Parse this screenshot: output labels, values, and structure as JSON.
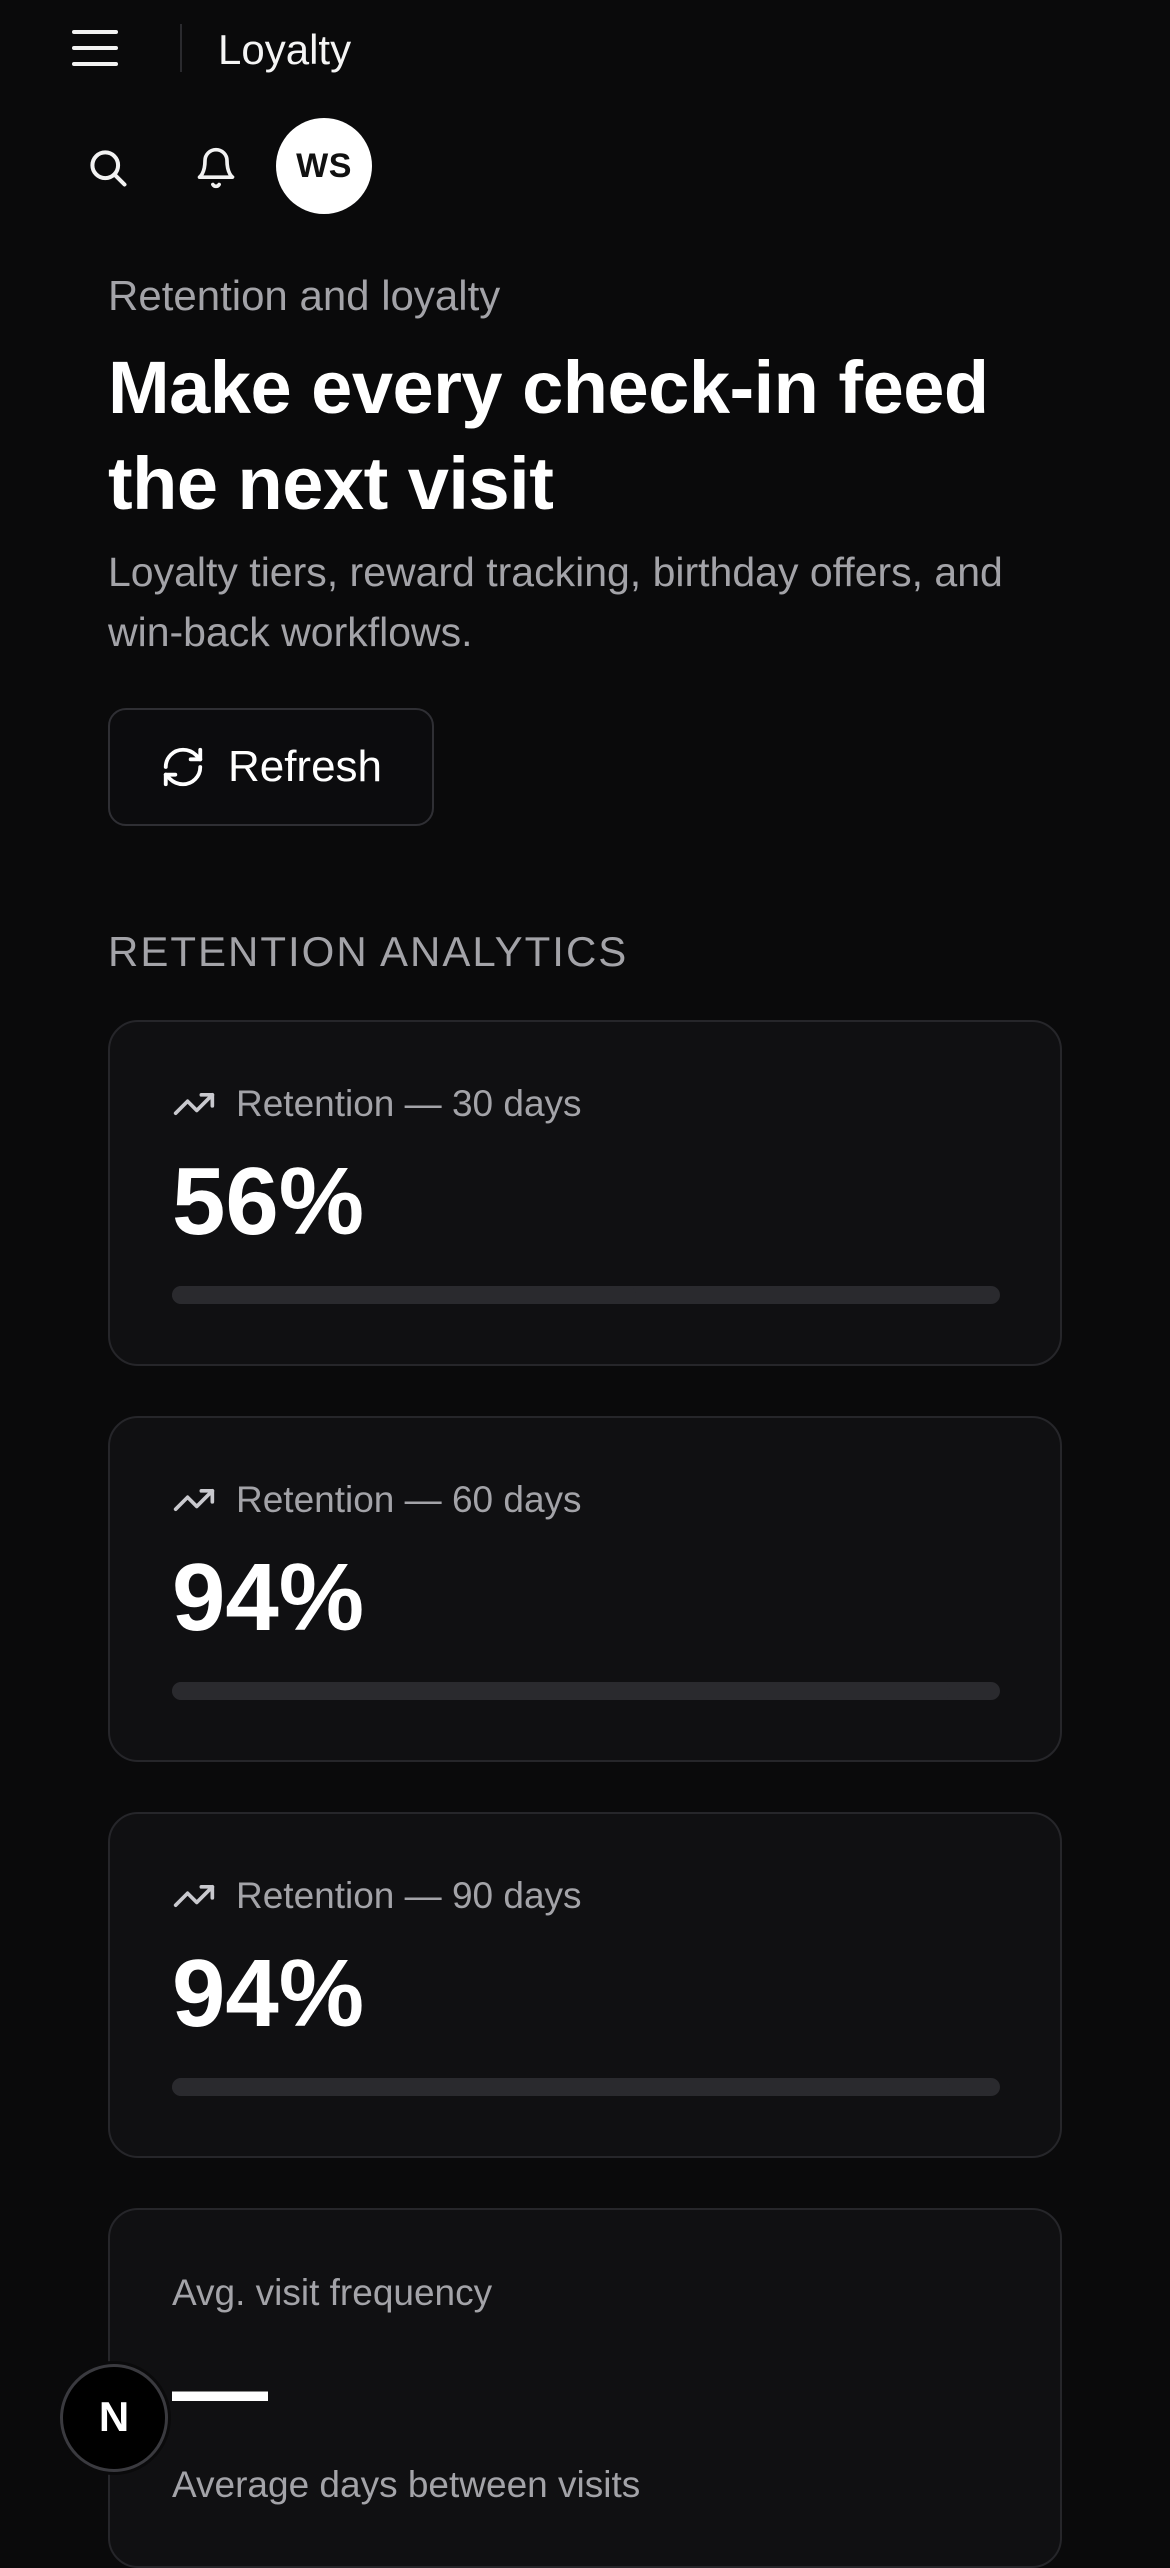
{
  "header": {
    "title": "Loyalty",
    "avatar_initials": "WS"
  },
  "hero": {
    "eyebrow": "Retention and loyalty",
    "title": "Make every check-in feed the next visit",
    "subtitle": "Loyalty tiers, reward tracking, birthday offers, and win-back workflows.",
    "refresh_label": "Refresh"
  },
  "analytics": {
    "section_label": "RETENTION ANALYTICS",
    "metrics": [
      {
        "label": "Retention — 30 days",
        "value": "56%",
        "progress": 0.56,
        "icon": "trending-up-icon"
      },
      {
        "label": "Retention — 60 days",
        "value": "94%",
        "progress": 0.94,
        "icon": "trending-up-icon"
      },
      {
        "label": "Retention — 90 days",
        "value": "94%",
        "progress": 0.94,
        "icon": "trending-up-icon"
      }
    ],
    "visit_frequency": {
      "label": "Avg. visit frequency",
      "value": "—",
      "note": "Average days between visits"
    }
  },
  "floating_badge": {
    "letter": "N"
  },
  "colors": {
    "background": "#0a0a0b",
    "card": "#101012",
    "card_border": "#26262a",
    "muted_text": "#a3a3a8",
    "bar_track": "#2a2a2e"
  }
}
